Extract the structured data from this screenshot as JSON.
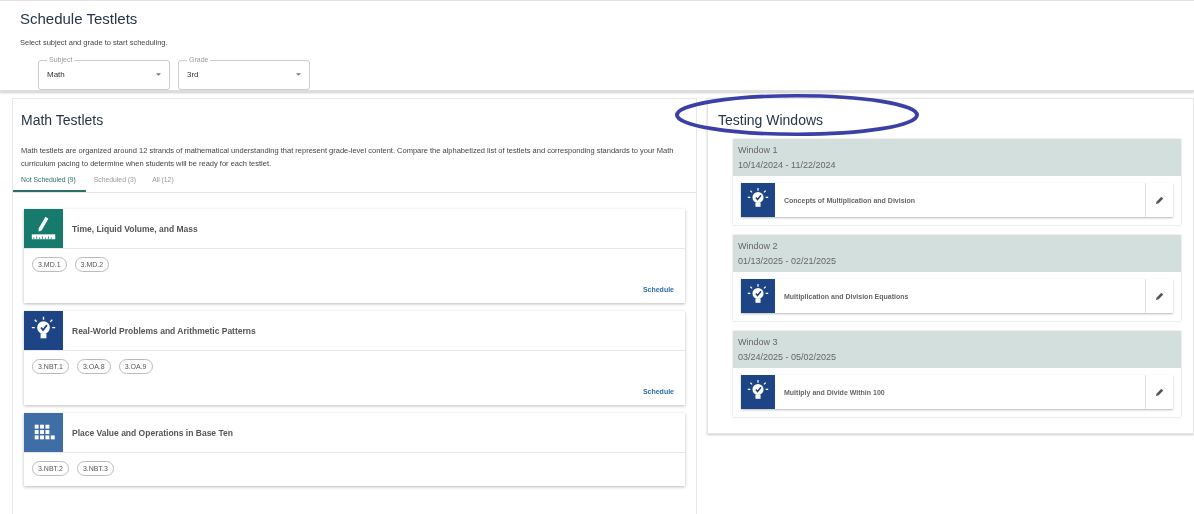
{
  "header": {
    "title": "Schedule Testlets",
    "subtitle": "Select subject and grade to start scheduling.",
    "selects": [
      {
        "label": "Subject",
        "value": "Math"
      },
      {
        "label": "Grade",
        "value": "3rd"
      }
    ]
  },
  "testlets": {
    "title": "Math Testlets",
    "description": "Math testlets are organized around 12 strands of mathematical understanding that represent grade-level content. Compare the alphabetized list of testlets and corresponding standards to your Math curriculum pacing to determine when students will be ready for each testlet.",
    "tabs": [
      {
        "label": "Not Scheduled (9)",
        "selected": true
      },
      {
        "label": "Scheduled (3)",
        "selected": false
      },
      {
        "label": "All (12)",
        "selected": false
      }
    ],
    "cards": [
      {
        "kind": "pencil-ruler",
        "color": "#167a6c",
        "title": "Time, Liquid Volume, and Mass",
        "standards": [
          "3.MD.1",
          "3.MD.2"
        ],
        "action": "Schedule"
      },
      {
        "kind": "lightbulb",
        "color": "#1d4585",
        "title": "Real-World Problems and Arithmetic Patterns",
        "standards": [
          "3.NBT.1",
          "3.OA.8",
          "3.OA.9"
        ],
        "action": "Schedule"
      },
      {
        "kind": "grid",
        "color": "#3f6ea6",
        "title": "Place Value and Operations in Base Ten",
        "standards": [
          "3.NBT.2",
          "3.NBT.3"
        ]
      }
    ]
  },
  "testing_windows": {
    "title": "Testing Windows",
    "circled": true,
    "windows": [
      {
        "name": "Window 1",
        "dates": "10/14/2024 - 11/22/2024",
        "testlet": "Concepts of Multiplication and Division"
      },
      {
        "name": "Window 2",
        "dates": "01/13/2025 - 02/21/2025",
        "testlet": "Multiplication and Division Equations"
      },
      {
        "name": "Window 3",
        "dates": "03/24/2025 - 05/02/2025",
        "testlet": "Multiply and Divide Within 100"
      }
    ]
  }
}
